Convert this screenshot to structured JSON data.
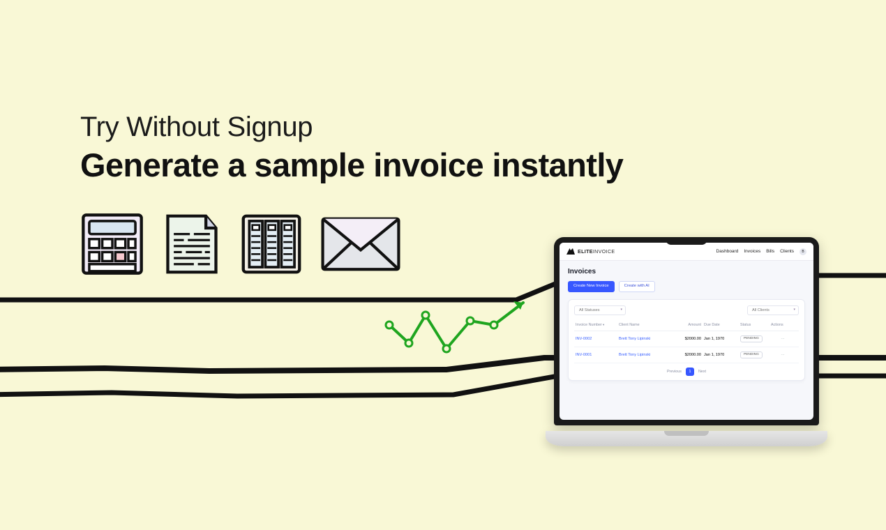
{
  "hero": {
    "subheadline": "Try Without Signup",
    "headline": "Generate a sample invoice instantly"
  },
  "icons": {
    "calculator": "calculator-icon",
    "document": "document-icon",
    "cabinet": "file-cabinet-icon",
    "envelope": "envelope-icon",
    "trend": "chart-arrow-icon"
  },
  "app": {
    "brand": {
      "bold": "ELITE",
      "thin": "INVOICE"
    },
    "nav": {
      "dashboard": "Dashboard",
      "invoices": "Invoices",
      "bills": "Bills",
      "clients": "Clients",
      "avatar_initial": "B"
    },
    "page_title": "Invoices",
    "buttons": {
      "create": "Create New Invoice",
      "create_ai": "Create with AI"
    },
    "filters": {
      "status": "All Statuses",
      "client": "All Clients"
    },
    "columns": {
      "number": "Invoice Number",
      "client": "Client Name",
      "amount": "Amount",
      "due": "Due Date",
      "status": "Status",
      "actions": "Actions"
    },
    "rows": [
      {
        "number": "INV-0002",
        "client": "Brett Tony Lipinski",
        "amount": "$2000.00",
        "due": "Jan 1, 1970",
        "status": "PENDING",
        "actions": "···"
      },
      {
        "number": "INV-0001",
        "client": "Brett Tony Lipinski",
        "amount": "$2000.00",
        "due": "Jan 1, 1970",
        "status": "PENDING",
        "actions": "···"
      }
    ],
    "pager": {
      "prev": "Previous",
      "page": "1",
      "next": "Next"
    }
  }
}
